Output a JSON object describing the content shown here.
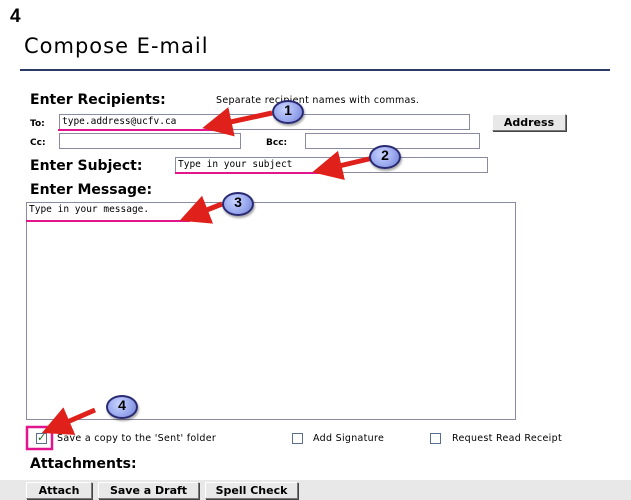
{
  "step_number": "4",
  "page_title": "Compose E-mail",
  "recipients": {
    "heading": "Enter Recipients:",
    "hint": "Separate recipient names with commas.",
    "to_label": "To:",
    "to_value": "type.address@ucfv.ca",
    "cc_label": "Cc:",
    "cc_value": "",
    "bcc_label": "Bcc:",
    "bcc_value": "",
    "address_button": "Address"
  },
  "subject": {
    "label": "Enter Subject:",
    "value": "Type in your subject"
  },
  "message": {
    "label": "Enter Message:",
    "value": "Type in your message."
  },
  "options": {
    "save_copy": {
      "label": "Save a copy to the 'Sent' folder",
      "checked": true
    },
    "add_signature": {
      "label": "Add Signature",
      "checked": false
    },
    "read_receipt": {
      "label": "Request Read Receipt",
      "checked": false
    }
  },
  "attachments_label": "Attachments:",
  "buttons": {
    "attach": "Attach",
    "save_draft": "Save a Draft",
    "spell_check": "Spell Check"
  },
  "callouts": [
    "1",
    "2",
    "3",
    "4"
  ],
  "colors": {
    "annotation_red": "#e0201a",
    "annotation_pink": "#e2158f",
    "badge_fill": "#9aa9ee",
    "title_rule": "#2b3a67"
  }
}
